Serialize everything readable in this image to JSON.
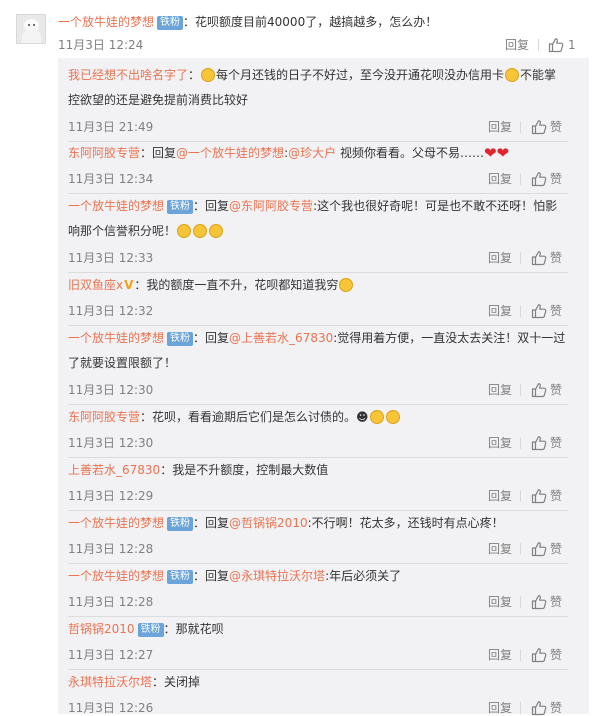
{
  "main_comment": {
    "username": "一个放牛娃的梦想",
    "badge": "铁粉",
    "separator": "：",
    "text": "花呗额度目前40000了，越搞越多，怎么办！",
    "time": "11月3日 12:24",
    "reply_label": "回复",
    "like_count": "1",
    "avatar_icon": "poodle-avatar-icon"
  },
  "replies": [
    {
      "username": "我已经想不出啥名字了",
      "separator": "：",
      "text_a": "每个月还钱的日子不好过，至今没开通花呗没办信用卡",
      "text_b": "不能掌控欲望的还是避免提前消费比较好",
      "time": "11月3日 21:49",
      "reply_label": "回复",
      "like_label": "赞"
    },
    {
      "username": "东阿阿胶专营",
      "separator": "：",
      "reply_prefix": "回复",
      "mention": "@一个放牛娃的梦想",
      "colon": ":",
      "mention2": "@珍大户",
      "text": " 视频你看看。父母不易……",
      "time": "11月3日 12:34",
      "reply_label": "回复",
      "like_label": "赞"
    },
    {
      "username": "一个放牛娃的梦想",
      "badge": "铁粉",
      "separator": "：",
      "reply_prefix": "回复",
      "mention": "@东阿阿胶专营",
      "text": ":这个我也很好奇呢！可是也不敢不还呀！怕影响那个信誉积分呢！",
      "time": "11月3日 12:33",
      "reply_label": "回复",
      "like_label": "赞"
    },
    {
      "username": "旧双鱼座x",
      "separator": "：",
      "text": "我的额度一直不升，花呗都知道我穷",
      "time": "11月3日 12:32",
      "reply_label": "回复",
      "like_label": "赞"
    },
    {
      "username": "一个放牛娃的梦想",
      "badge": "铁粉",
      "separator": "：",
      "reply_prefix": "回复",
      "mention": "@上善若水_67830",
      "text": ":觉得用着方便，一直没太去关注！双十一过了就要设置限额了！",
      "time": "11月3日 12:30",
      "reply_label": "回复",
      "like_label": "赞"
    },
    {
      "username": "东阿阿胶专营",
      "separator": "：",
      "text": "花呗，看看逾期后它们是怎么讨债的。",
      "time": "11月3日 12:30",
      "reply_label": "回复",
      "like_label": "赞"
    },
    {
      "username": "上善若水_67830",
      "separator": "：",
      "text": "我是不升额度，控制最大数值",
      "time": "11月3日 12:29",
      "reply_label": "回复",
      "like_label": "赞"
    },
    {
      "username": "一个放牛娃的梦想",
      "badge": "铁粉",
      "separator": "：",
      "reply_prefix": "回复",
      "mention": "@哲锅锅2010",
      "text": ":不行啊！花太多，还钱时有点心疼！",
      "time": "11月3日 12:28",
      "reply_label": "回复",
      "like_label": "赞"
    },
    {
      "username": "一个放牛娃的梦想",
      "badge": "铁粉",
      "separator": "：",
      "reply_prefix": "回复",
      "mention": "@永琪特拉沃尔塔",
      "text": ":年后必须关了",
      "time": "11月3日 12:28",
      "reply_label": "回复",
      "like_label": "赞"
    },
    {
      "username": "哲锅锅2010",
      "badge": "铁粉",
      "separator": "：",
      "text": "那就花呗",
      "time": "11月3日 12:27",
      "reply_label": "回复",
      "like_label": "赞"
    },
    {
      "username": "永琪特拉沃尔塔",
      "separator": "：",
      "text": "关闭掉",
      "time": "11月3日 12:26",
      "reply_label": "回复",
      "like_label": "赞"
    }
  ],
  "colors": {
    "username": "#eb7350",
    "badge": "#6aa4d9",
    "meta": "#808080",
    "reply_box": "#f2f2f5"
  }
}
